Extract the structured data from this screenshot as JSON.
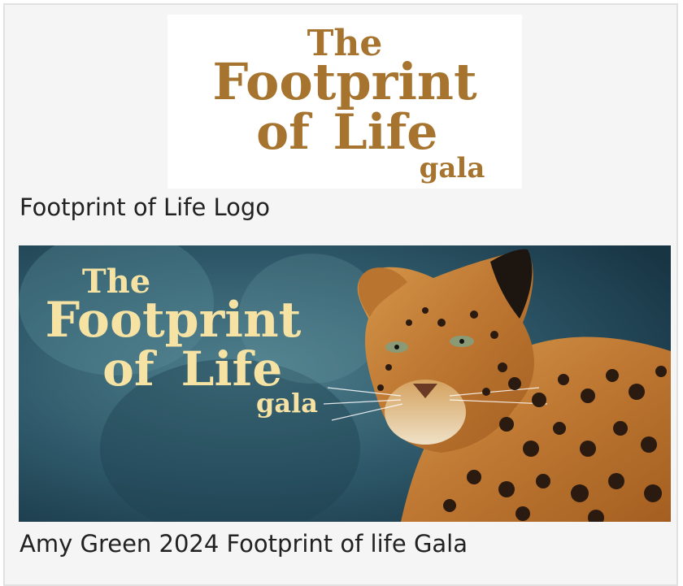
{
  "items": [
    {
      "caption": "Footprint of Life Logo",
      "logo_text": {
        "the": "The",
        "footprint": "Footprint",
        "of": "of",
        "life": "Life",
        "gala": "gala"
      },
      "logo_color": "#a6742e"
    },
    {
      "caption": "Amy Green 2024 Footprint of life Gala",
      "logo_text": {
        "the": "The",
        "footprint": "Footprint",
        "of": "of",
        "life": "Life",
        "gala": "gala"
      },
      "logo_color": "#f6e3a4"
    }
  ],
  "colors": {
    "panel_bg": "#f5f5f5",
    "banner_bg": "#2d5566",
    "leopard": "#c88535"
  }
}
